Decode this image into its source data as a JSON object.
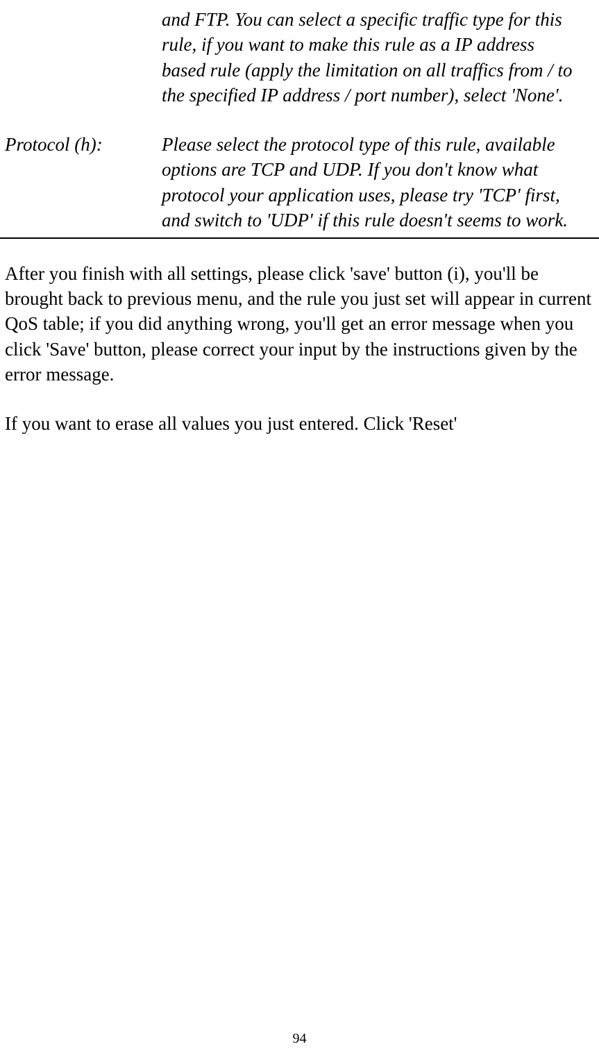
{
  "defs": {
    "traffic_type_desc": "and FTP. You can select a specific traffic type for this rule, if you want to make this rule as a IP address based rule (apply the limitation on all traffics from / to the specified IP address / port number), select 'None'.",
    "protocol_label": "Protocol (h):",
    "protocol_desc": "Please select the protocol type of this rule, available options are TCP and UDP. If you don't know what protocol your application uses, please try 'TCP' first, and switch to 'UDP' if this rule doesn't seems to work."
  },
  "paragraphs": {
    "p1": "After you finish with all settings, please click 'save' button (i), you'll be brought back to previous menu, and the rule you just set will appear in current QoS table; if you did anything wrong, you'll get an error message when you click 'Save' button, please correct your input by the instructions given by the error message.",
    "p2": "If you want to erase all values you just entered. Click 'Reset'"
  },
  "page_number": "94"
}
